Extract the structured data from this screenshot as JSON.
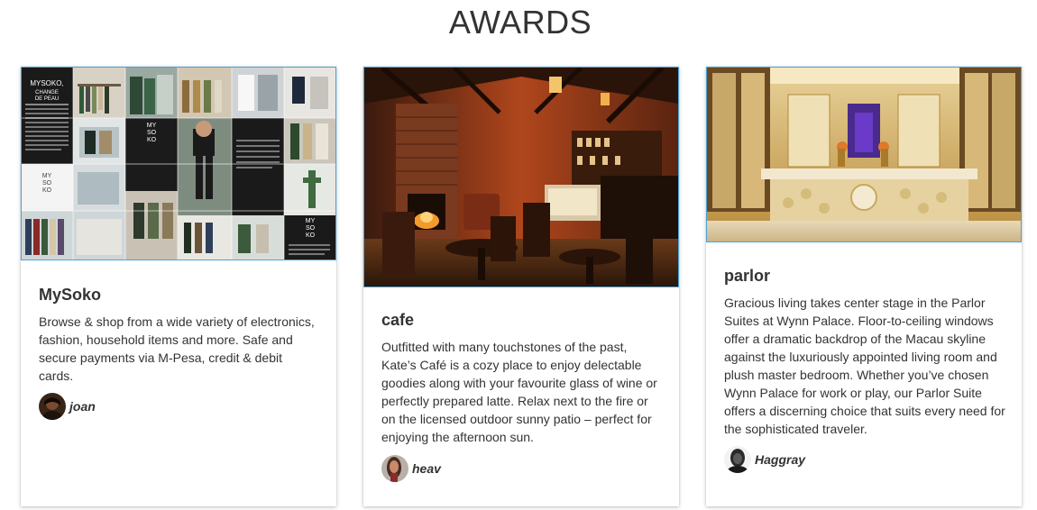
{
  "page": {
    "title": "AWARDS"
  },
  "cards": [
    {
      "title": "MySoko",
      "text": "Browse & shop from a wide variety of electronics, fashion, household items and more. Safe and secure payments via M-Pesa, credit & debit cards.",
      "author": "joan",
      "image_icon": "fashion-store-collage-image",
      "image_text": {
        "headline1": "MYSOKO,",
        "headline2": "CHANGE",
        "headline3": "DE PEAU",
        "logo": [
          "MY",
          "SO",
          "KO"
        ]
      }
    },
    {
      "title": "cafe",
      "text": "Outfitted with many touchstones of the past, Kate’s Café is a cozy place to enjoy delectable goodies along with your favourite glass of wine or perfectly prepared latte. Relax next to the fire or on the licensed outdoor sunny patio – perfect for enjoying the afternoon sun.",
      "author": "heav",
      "image_icon": "cafe-interior-image"
    },
    {
      "title": "parlor",
      "text": "Gracious living takes center stage in the Parlor Suites at Wynn Palace. Floor-to-ceiling windows offer a dramatic backdrop of the Macau skyline against the luxuriously appointed living room and plush master bedroom. Whether you’ve chosen Wynn Palace for work or play, our Parlor Suite offers a discerning choice that suits every need for the sophisticated traveler.",
      "author": "Haggray",
      "image_icon": "luxury-bathroom-image"
    }
  ],
  "colors": {
    "image_border": "#4aa3d6",
    "text": "#333333"
  }
}
